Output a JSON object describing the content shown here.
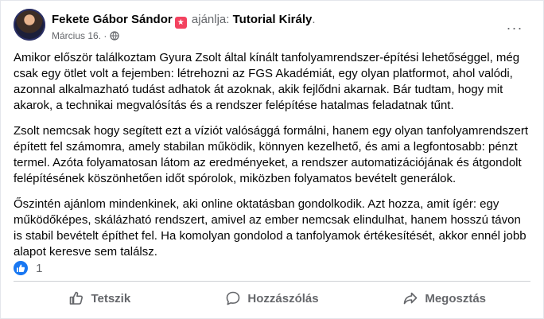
{
  "post": {
    "author": "Fekete Gábor Sándor",
    "recommends_label": "ajánlja:",
    "page": "Tutorial Király",
    "page_suffix": ".",
    "date": "Március 16.",
    "separator": "·",
    "more_label": "···",
    "paragraphs": [
      "Amikor először találkoztam Gyura Zsolt által kínált tanfolyamrendszer-építési lehetőséggel, még csak egy ötlet volt a fejemben: létrehozni az FGS Akadémiát, egy olyan platformot, ahol valódi, azonnal alkalmazható tudást adhatok át azoknak, akik fejlődni akarnak. Bár tudtam, hogy mit akarok, a technikai megvalósítás és a rendszer felépítése hatalmas feladatnak tűnt.",
      "Zsolt nemcsak hogy segített ezt a víziót valósággá formálni, hanem egy olyan tanfolyamrendszert épített fel számomra, amely stabilan működik, könnyen kezelhető, és ami a legfontosabb: pénzt termel. Azóta folyamatosan látom az eredményeket, a rendszer automatizációjának és átgondolt felépítésének köszönhetően időt spórolok, miközben folyamatos bevételt generálok.",
      "Őszintén ajánlom mindenkinek, aki online oktatásban gondolkodik. Azt hozza, amit ígér: egy működőképes, skálázható rendszert, amivel az ember nemcsak elindulhat, hanem hosszú távon is stabil bevételt építhet fel. Ha komolyan gondolod a tanfolyamok értékesítését, akkor ennél jobb alapot keresve sem találsz."
    ],
    "reaction_count": "1"
  },
  "actions": {
    "like": "Tetszik",
    "comment": "Hozzászólás",
    "share": "Megosztás"
  },
  "icons": {
    "recommend_badge": "star-badge-icon",
    "privacy": "globe-icon",
    "more": "more-dots-icon",
    "reaction": "like-reaction-icon",
    "like": "thumbs-up-icon",
    "comment": "comment-bubble-icon",
    "share": "share-arrow-icon"
  },
  "colors": {
    "accent": "#1877f2",
    "recommend_badge": "#f3425f",
    "secondary_text": "#65676b"
  }
}
